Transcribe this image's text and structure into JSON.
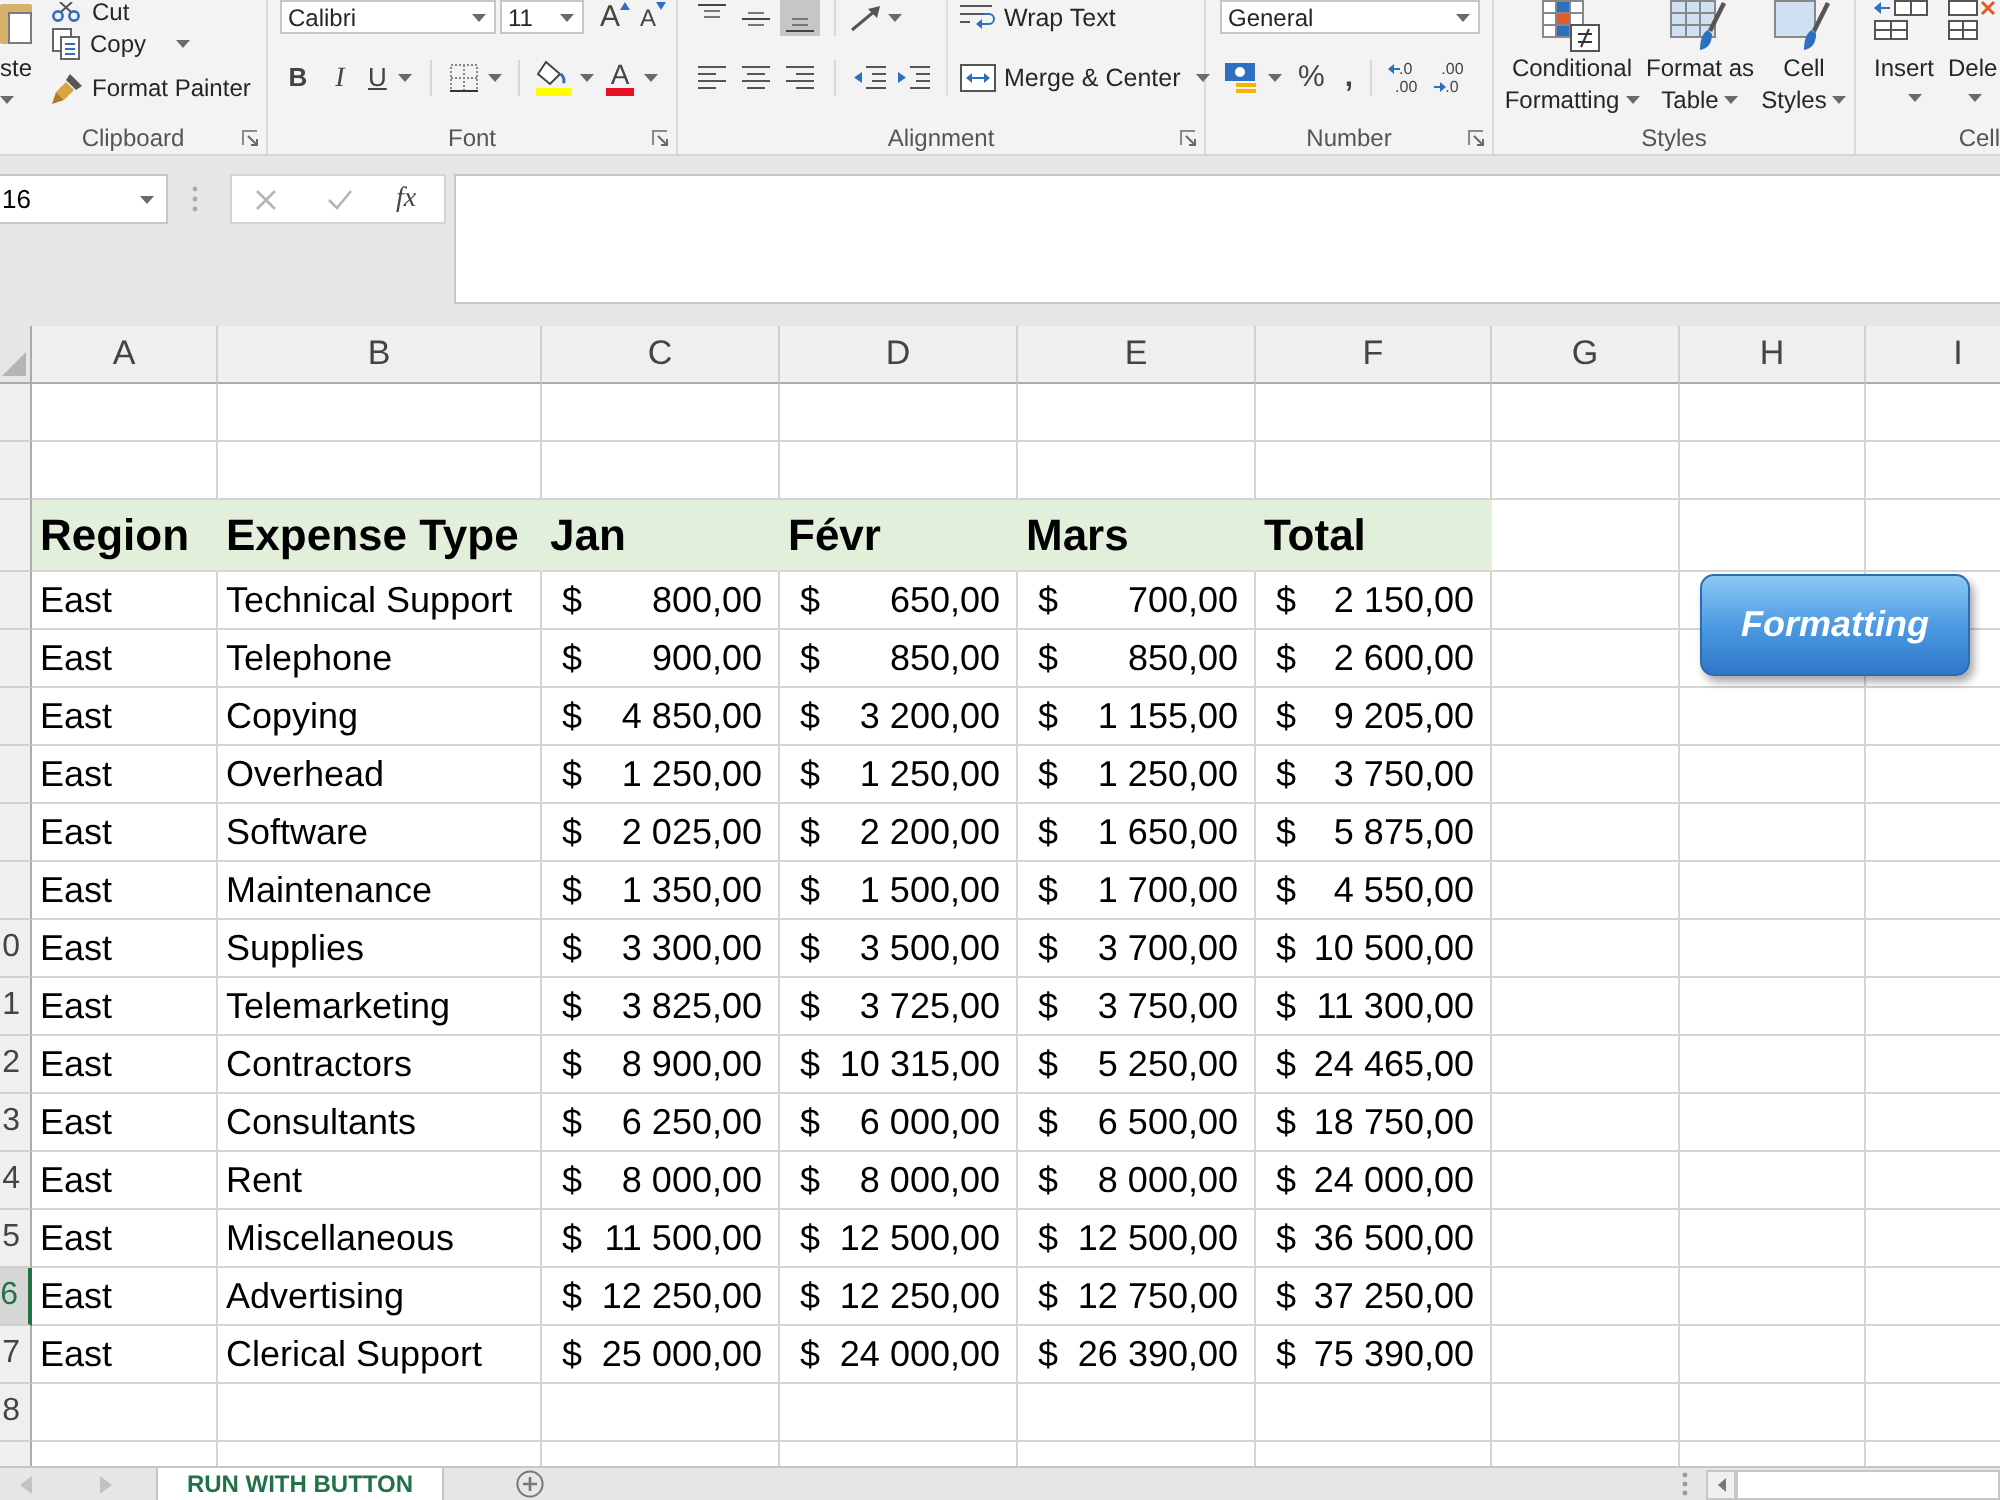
{
  "ribbon": {
    "clipboard": {
      "label": "Clipboard",
      "paste": "ste",
      "cut": "Cut",
      "copy": "Copy",
      "format_painter": "Format Painter"
    },
    "font": {
      "label": "Font",
      "font_name": "Calibri",
      "font_size": "11",
      "grow_font": "A",
      "shrink_font": "A",
      "bold": "B",
      "italic": "I",
      "underline": "U",
      "font_color": "A"
    },
    "alignment": {
      "label": "Alignment",
      "vertical_align": [
        {
          "kind": "top",
          "selected": false
        },
        {
          "kind": "middle",
          "selected": false
        },
        {
          "kind": "bottom",
          "selected": true
        }
      ],
      "horizontal_align": [
        {
          "kind": "left",
          "selected": false
        },
        {
          "kind": "center",
          "selected": false
        },
        {
          "kind": "right",
          "selected": false
        }
      ],
      "wrap_text": "Wrap Text",
      "merge_center": "Merge & Center"
    },
    "number": {
      "label": "Number",
      "format": "General",
      "percent": "%",
      "comma": ",",
      "increase_decimal": {
        "top": ".0",
        "bottom": ".00"
      },
      "decrease_decimal": {
        "top": ".00",
        "bottom": ".0"
      }
    },
    "styles": {
      "label": "Styles",
      "buttons": [
        {
          "kind": "conditional",
          "lines": [
            "Conditional",
            "Formatting"
          ]
        },
        {
          "kind": "table",
          "lines": [
            "Format as",
            "Table"
          ]
        },
        {
          "kind": "cell_styles",
          "lines": [
            "Cell",
            "Styles"
          ]
        }
      ]
    },
    "cells": {
      "label": "Cell",
      "buttons": [
        {
          "kind": "insert",
          "label": "Insert"
        },
        {
          "kind": "delete",
          "label": "Dele"
        }
      ]
    }
  },
  "formula_bar": {
    "name_box": "16",
    "function_button": "fx"
  },
  "sheet": {
    "columns": [
      "A",
      "B",
      "C",
      "D",
      "E",
      "F",
      "G",
      "H",
      "I"
    ],
    "rows": [
      {
        "kind": "blank",
        "selected": false
      },
      {
        "kind": "blank",
        "selected": false
      },
      {
        "kind": "header",
        "selected": false,
        "cells": [
          "Region",
          "Expense Type",
          "Jan",
          "Févr",
          "Mars",
          "Total"
        ]
      },
      {
        "kind": "data",
        "selected": false,
        "region": "East",
        "expense_type": "Technical Support",
        "amounts": [
          {
            "currency": "$",
            "value": "800,00"
          },
          {
            "currency": "$",
            "value": "650,00"
          },
          {
            "currency": "$",
            "value": "700,00"
          },
          {
            "currency": "$",
            "value": "2 150,00"
          }
        ]
      },
      {
        "kind": "data",
        "selected": false,
        "region": "East",
        "expense_type": "Telephone",
        "amounts": [
          {
            "currency": "$",
            "value": "900,00"
          },
          {
            "currency": "$",
            "value": "850,00"
          },
          {
            "currency": "$",
            "value": "850,00"
          },
          {
            "currency": "$",
            "value": "2 600,00"
          }
        ]
      },
      {
        "kind": "data",
        "selected": false,
        "region": "East",
        "expense_type": "Copying",
        "amounts": [
          {
            "currency": "$",
            "value": "4 850,00"
          },
          {
            "currency": "$",
            "value": "3 200,00"
          },
          {
            "currency": "$",
            "value": "1 155,00"
          },
          {
            "currency": "$",
            "value": "9 205,00"
          }
        ]
      },
      {
        "kind": "data",
        "selected": false,
        "region": "East",
        "expense_type": "Overhead",
        "amounts": [
          {
            "currency": "$",
            "value": "1 250,00"
          },
          {
            "currency": "$",
            "value": "1 250,00"
          },
          {
            "currency": "$",
            "value": "1 250,00"
          },
          {
            "currency": "$",
            "value": "3 750,00"
          }
        ]
      },
      {
        "kind": "data",
        "selected": false,
        "region": "East",
        "expense_type": "Software",
        "amounts": [
          {
            "currency": "$",
            "value": "2 025,00"
          },
          {
            "currency": "$",
            "value": "2 200,00"
          },
          {
            "currency": "$",
            "value": "1 650,00"
          },
          {
            "currency": "$",
            "value": "5 875,00"
          }
        ]
      },
      {
        "kind": "data",
        "selected": false,
        "region": "East",
        "expense_type": "Maintenance",
        "amounts": [
          {
            "currency": "$",
            "value": "1 350,00"
          },
          {
            "currency": "$",
            "value": "1 500,00"
          },
          {
            "currency": "$",
            "value": "1 700,00"
          },
          {
            "currency": "$",
            "value": "4 550,00"
          }
        ]
      },
      {
        "kind": "data",
        "header": "0",
        "selected": false,
        "region": "East",
        "expense_type": "Supplies",
        "amounts": [
          {
            "currency": "$",
            "value": "3 300,00"
          },
          {
            "currency": "$",
            "value": "3 500,00"
          },
          {
            "currency": "$",
            "value": "3 700,00"
          },
          {
            "currency": "$",
            "value": "10 500,00"
          }
        ]
      },
      {
        "kind": "data",
        "header": "1",
        "selected": false,
        "region": "East",
        "expense_type": "Telemarketing",
        "amounts": [
          {
            "currency": "$",
            "value": "3 825,00"
          },
          {
            "currency": "$",
            "value": "3 725,00"
          },
          {
            "currency": "$",
            "value": "3 750,00"
          },
          {
            "currency": "$",
            "value": "11 300,00"
          }
        ]
      },
      {
        "kind": "data",
        "header": "2",
        "selected": false,
        "region": "East",
        "expense_type": "Contractors",
        "amounts": [
          {
            "currency": "$",
            "value": "8 900,00"
          },
          {
            "currency": "$",
            "value": "10 315,00"
          },
          {
            "currency": "$",
            "value": "5 250,00"
          },
          {
            "currency": "$",
            "value": "24 465,00"
          }
        ]
      },
      {
        "kind": "data",
        "header": "3",
        "selected": false,
        "region": "East",
        "expense_type": "Consultants",
        "amounts": [
          {
            "currency": "$",
            "value": "6 250,00"
          },
          {
            "currency": "$",
            "value": "6 000,00"
          },
          {
            "currency": "$",
            "value": "6 500,00"
          },
          {
            "currency": "$",
            "value": "18 750,00"
          }
        ]
      },
      {
        "kind": "data",
        "header": "4",
        "selected": false,
        "region": "East",
        "expense_type": "Rent",
        "amounts": [
          {
            "currency": "$",
            "value": "8 000,00"
          },
          {
            "currency": "$",
            "value": "8 000,00"
          },
          {
            "currency": "$",
            "value": "8 000,00"
          },
          {
            "currency": "$",
            "value": "24 000,00"
          }
        ]
      },
      {
        "kind": "data",
        "header": "5",
        "selected": false,
        "region": "East",
        "expense_type": "Miscellaneous",
        "amounts": [
          {
            "currency": "$",
            "value": "11 500,00"
          },
          {
            "currency": "$",
            "value": "12 500,00"
          },
          {
            "currency": "$",
            "value": "12 500,00"
          },
          {
            "currency": "$",
            "value": "36 500,00"
          }
        ]
      },
      {
        "kind": "data",
        "header": "6",
        "selected": true,
        "region": "East",
        "expense_type": "Advertising",
        "amounts": [
          {
            "currency": "$",
            "value": "12 250,00"
          },
          {
            "currency": "$",
            "value": "12 250,00"
          },
          {
            "currency": "$",
            "value": "12 750,00"
          },
          {
            "currency": "$",
            "value": "37 250,00"
          }
        ]
      },
      {
        "kind": "data",
        "header": "7",
        "selected": false,
        "region": "East",
        "expense_type": "Clerical Support",
        "amounts": [
          {
            "currency": "$",
            "value": "25 000,00"
          },
          {
            "currency": "$",
            "value": "24 000,00"
          },
          {
            "currency": "$",
            "value": "26 390,00"
          },
          {
            "currency": "$",
            "value": "75 390,00"
          }
        ]
      },
      {
        "kind": "blank",
        "header": "8",
        "selected": false
      },
      {
        "kind": "blank",
        "selected": false
      }
    ]
  },
  "shape_button": {
    "label": "Formatting"
  },
  "sheet_tabs": [
    {
      "label": "RUN WITH BUTTON",
      "selected": true
    }
  ]
}
